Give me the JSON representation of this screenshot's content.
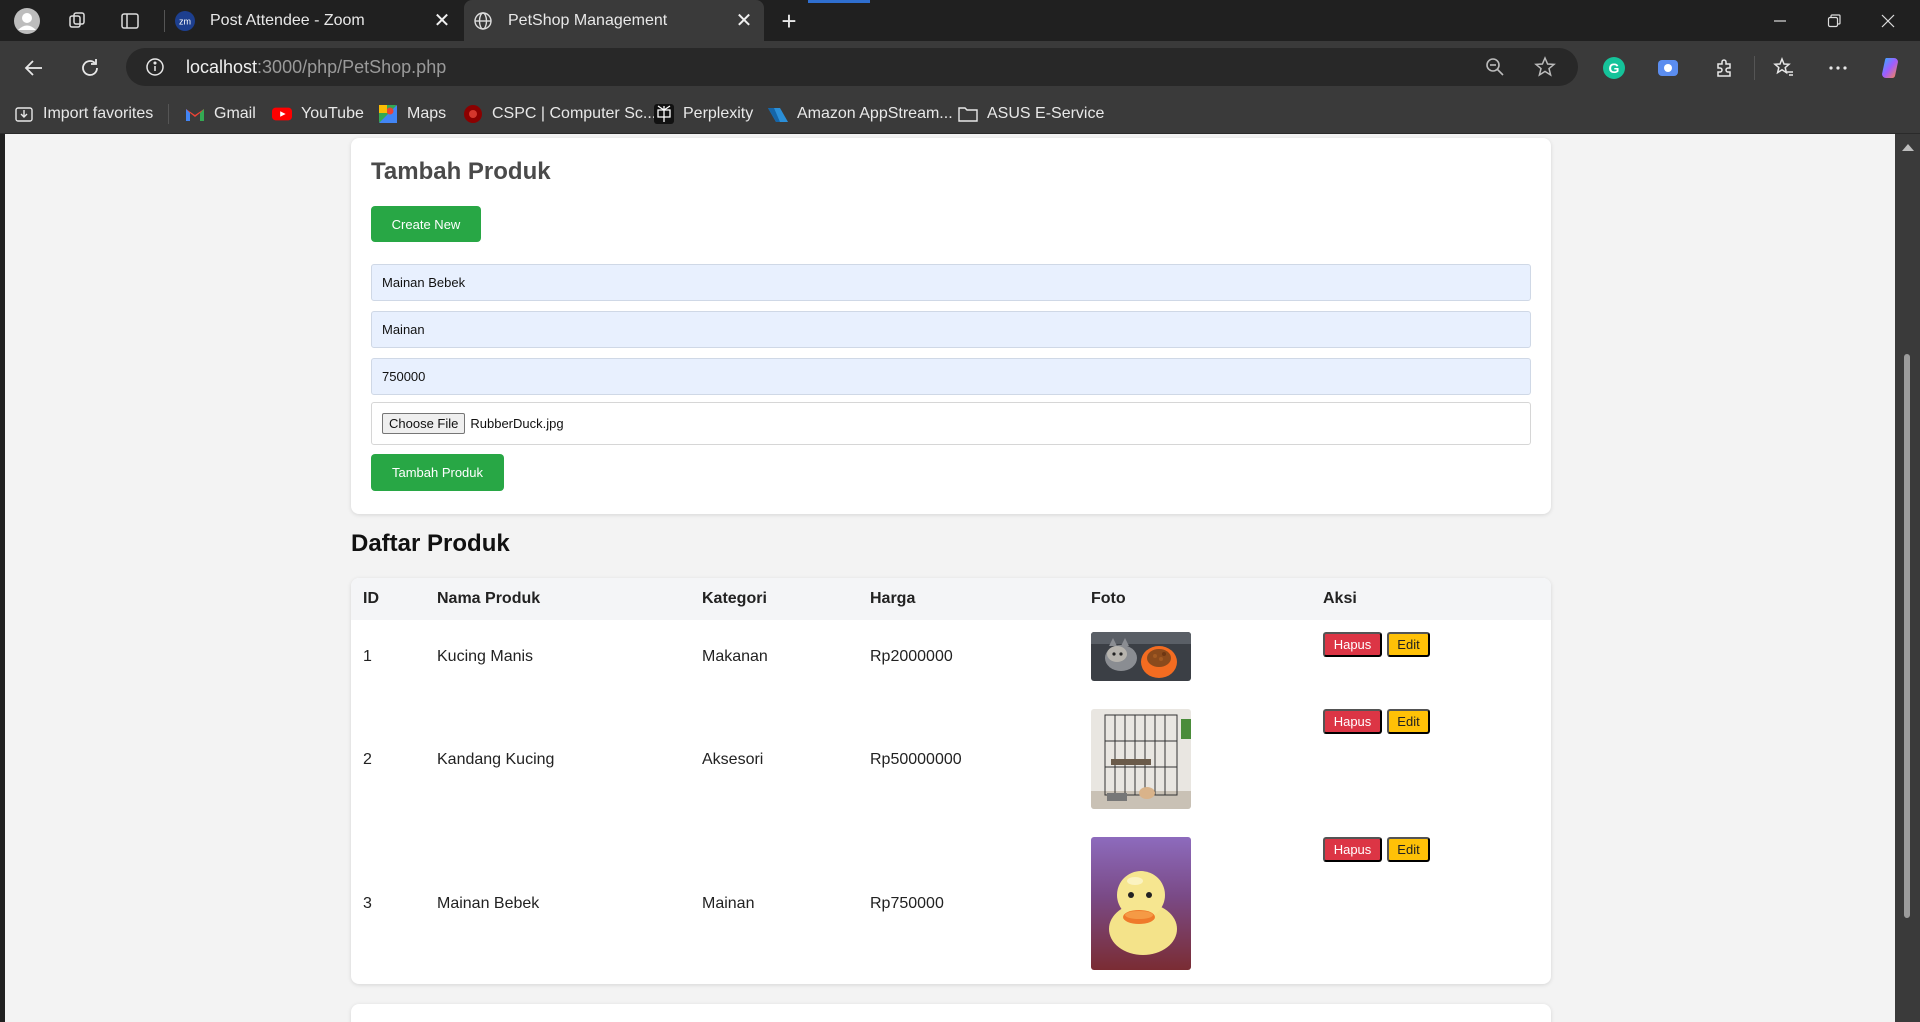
{
  "browser": {
    "tabs": [
      {
        "title": "Post Attendee - Zoom",
        "favicon": "zoom-icon",
        "active": false
      },
      {
        "title": "PetShop Management",
        "favicon": "globe-icon",
        "active": true
      }
    ],
    "address": {
      "host": "localhost",
      "path": ":3000/php/PetShop.php"
    },
    "bookmarks": [
      {
        "label": "Import favorites",
        "icon": "import-icon"
      },
      {
        "label": "Gmail",
        "icon": "gmail-icon"
      },
      {
        "label": "YouTube",
        "icon": "youtube-icon"
      },
      {
        "label": "Maps",
        "icon": "maps-icon"
      },
      {
        "label": "CSPC | Computer Sc...",
        "icon": "cspc-icon"
      },
      {
        "label": "Perplexity",
        "icon": "perplexity-icon"
      },
      {
        "label": "Amazon AppStream...",
        "icon": "appstream-icon"
      },
      {
        "label": "ASUS E-Service",
        "icon": "folder-icon"
      }
    ]
  },
  "form": {
    "title": "Tambah Produk",
    "create_label": "Create New",
    "nama": "Mainan Bebek",
    "kategori": "Mainan",
    "harga": "750000",
    "file_button": "Choose File",
    "file_name": "RubberDuck.jpg",
    "submit_label": "Tambah Produk"
  },
  "list": {
    "title": "Daftar Produk",
    "columns": [
      "ID",
      "Nama Produk",
      "Kategori",
      "Harga",
      "Foto",
      "Aksi"
    ],
    "rows": [
      {
        "id": "1",
        "nama": "Kucing Manis",
        "kategori": "Makanan",
        "harga": "Rp2000000",
        "foto": "cat-food-photo",
        "hapus": "Hapus",
        "edit": "Edit"
      },
      {
        "id": "2",
        "nama": "Kandang Kucing",
        "kategori": "Aksesori",
        "harga": "Rp50000000",
        "foto": "cat-cage-photo",
        "hapus": "Hapus",
        "edit": "Edit"
      },
      {
        "id": "3",
        "nama": "Mainan Bebek",
        "kategori": "Mainan",
        "harga": "Rp750000",
        "foto": "rubber-duck-photo",
        "hapus": "Hapus",
        "edit": "Edit"
      }
    ]
  },
  "colors": {
    "primary_green": "#28a745",
    "danger": "#dc3545",
    "warning": "#ffc107"
  }
}
